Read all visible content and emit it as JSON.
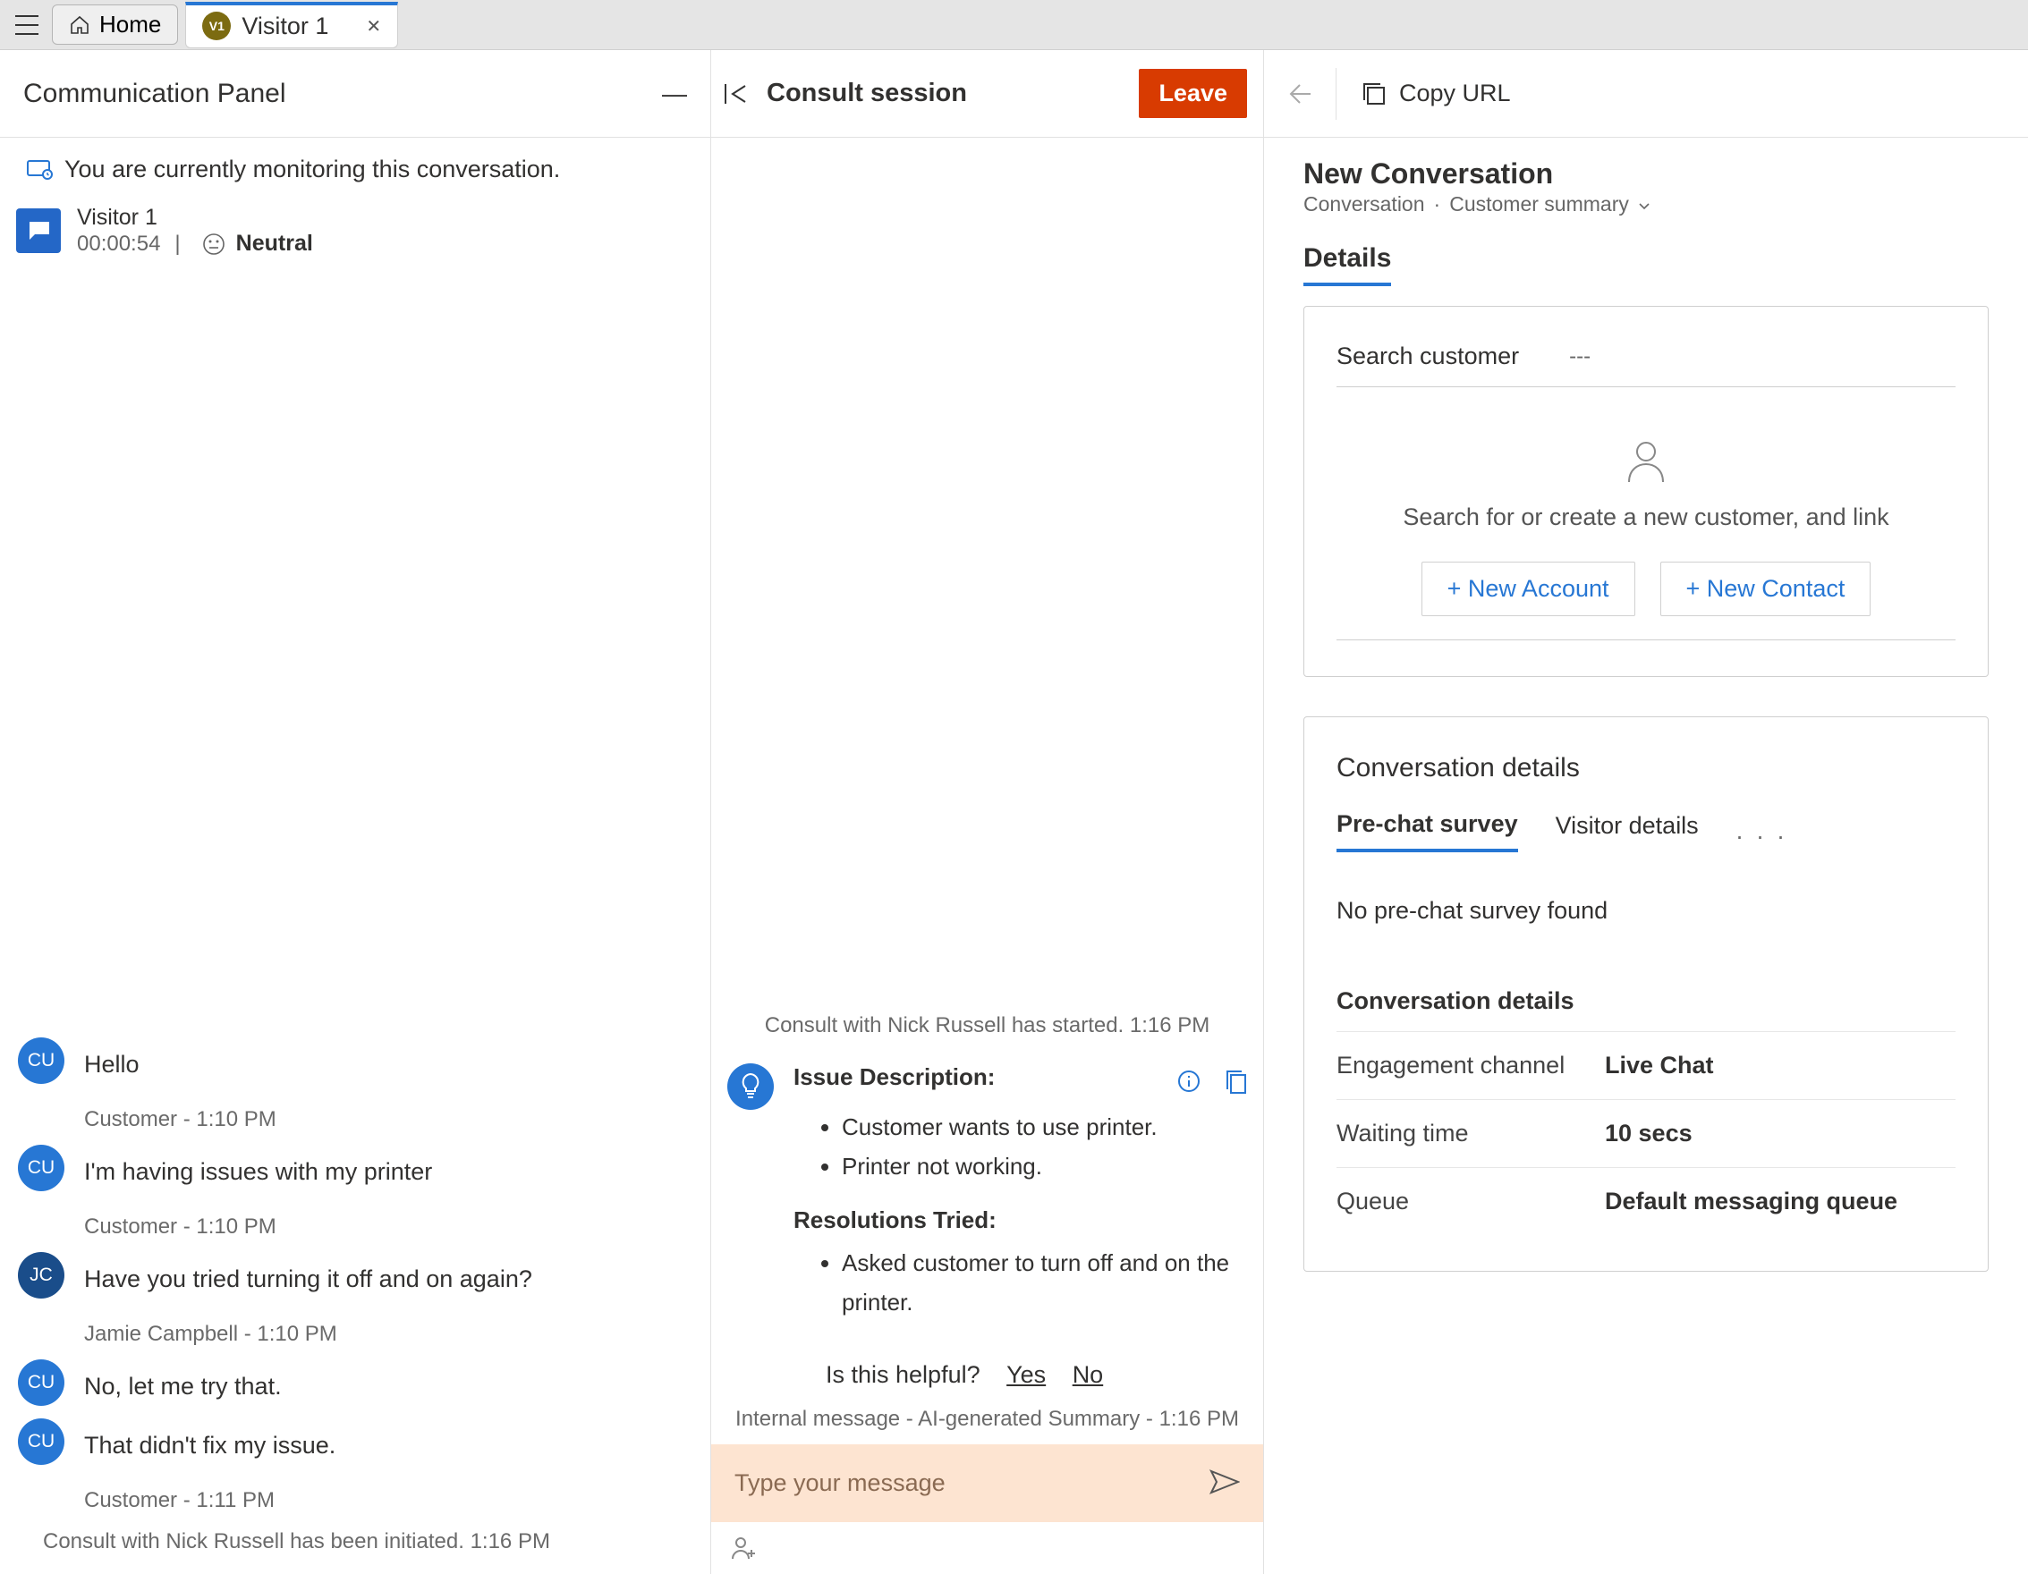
{
  "topbar": {
    "home_label": "Home",
    "tab_badge": "V1",
    "tab_label": "Visitor 1"
  },
  "left": {
    "panel_title": "Communication Panel",
    "monitor_notice": "You are currently monitoring this conversation.",
    "session": {
      "name": "Visitor 1",
      "timer": "00:00:54",
      "sentiment": "Neutral"
    },
    "messages": [
      {
        "avatar": "CU",
        "text": "Hello",
        "meta": "Customer - 1:10 PM"
      },
      {
        "avatar": "CU",
        "text": "I'm having issues with my printer",
        "meta": "Customer - 1:10 PM"
      },
      {
        "avatar": "JC",
        "text": "Have you tried turning it off and on again?",
        "meta": "Jamie Campbell - 1:10 PM"
      },
      {
        "avatar": "CU",
        "text": "No, let me try that.",
        "meta": ""
      },
      {
        "avatar": "CU",
        "text": "That didn't fix my issue.",
        "meta": "Customer - 1:11 PM"
      }
    ],
    "system_end": "Consult with Nick Russell has been initiated. 1:16 PM"
  },
  "middle": {
    "consult_title": "Consult session",
    "leave_label": "Leave",
    "consult_notice": "Consult with Nick Russell has started. 1:16 PM",
    "issue_heading": "Issue Description:",
    "issues": [
      "Customer wants to use printer.",
      "Printer not working."
    ],
    "res_heading": "Resolutions Tried:",
    "resolutions": [
      "Asked customer to turn off and on the printer."
    ],
    "feedback_q": "Is this helpful?",
    "feedback_yes": "Yes",
    "feedback_no": "No",
    "internal_meta": "Internal message - AI-generated Summary - 1:16 PM",
    "composer_placeholder": "Type your message"
  },
  "right": {
    "copy_url": "Copy URL",
    "form_title": "New Conversation",
    "breadcrumb1": "Conversation",
    "breadcrumb_sep": "·",
    "breadcrumb2": "Customer summary",
    "details_tab": "Details",
    "search_label": "Search customer",
    "search_value": "---",
    "empty_text": "Search for or create a new customer, and link",
    "new_account": "+ New Account",
    "new_contact": "+ New Contact",
    "conv_details_title": "Conversation details",
    "tab1": "Pre-chat survey",
    "tab2": "Visitor details",
    "no_survey": "No pre-chat survey found",
    "sub_title": "Conversation details",
    "rows": [
      {
        "k": "Engagement channel",
        "v": "Live Chat"
      },
      {
        "k": "Waiting time",
        "v": "10 secs"
      },
      {
        "k": "Queue",
        "v": "Default messaging queue"
      }
    ]
  }
}
